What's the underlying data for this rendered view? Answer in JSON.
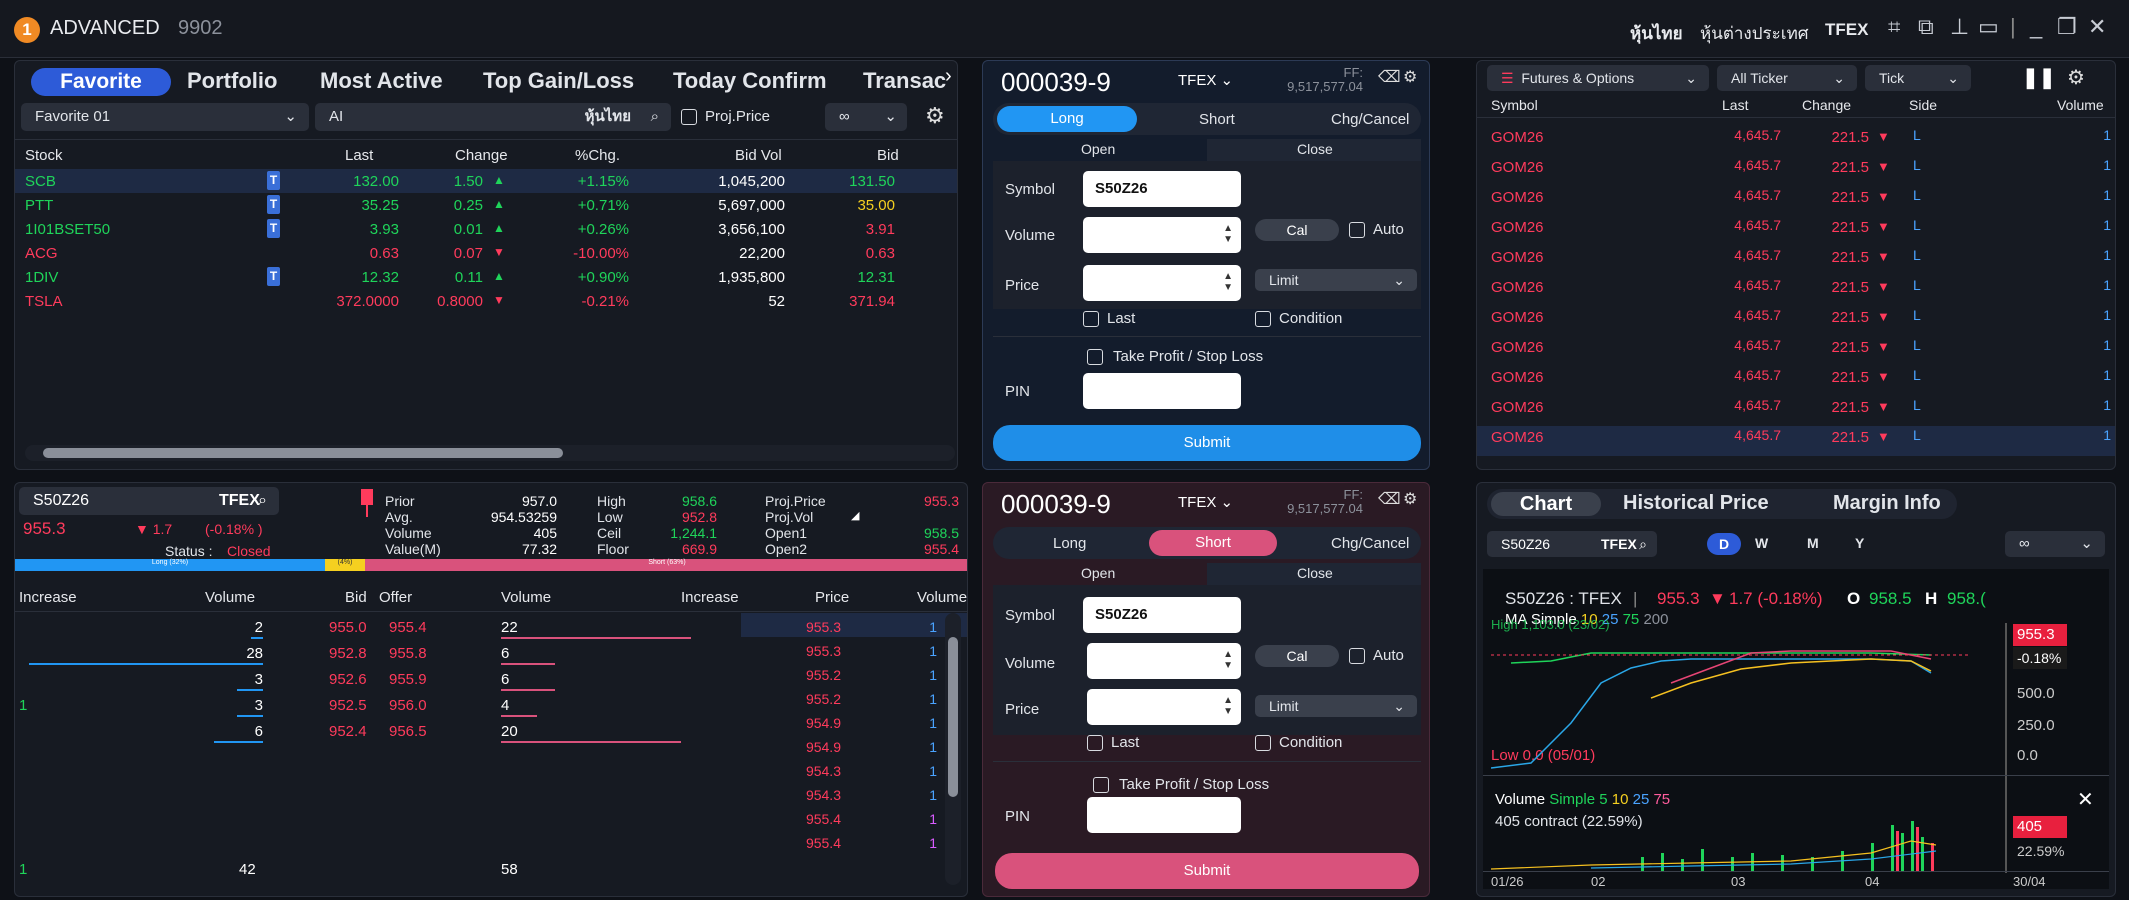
{
  "titlebar": {
    "badge": "1",
    "title": "ADVANCED",
    "account": "9902",
    "links": [
      "หุ้นไทย",
      "หุ้นต่างประเทศ",
      "TFEX"
    ]
  },
  "watchlist": {
    "tabs": [
      "Favorite",
      "Portfolio",
      "Most Active",
      "Top Gain/Loss",
      "Today Confirm",
      "Transac"
    ],
    "list_select": "Favorite 01",
    "search_value": "AI",
    "market_label": "หุ้นไทย",
    "proj_price_label": "Proj.Price",
    "columns": [
      "Stock",
      "Last",
      "Change",
      "%Chg.",
      "Bid Vol",
      "Bid"
    ],
    "rows": [
      {
        "stock": "SCB",
        "t": "T",
        "last": "132.00",
        "change": "1.50",
        "dir": "up",
        "pct": "+1.15%",
        "bidvol": "1,045,200",
        "bid": "131.50",
        "color": "g",
        "bidcolor": "g"
      },
      {
        "stock": "PTT",
        "t": "T",
        "last": "35.25",
        "change": "0.25",
        "dir": "up",
        "pct": "+0.71%",
        "bidvol": "5,697,000",
        "bid": "35.00",
        "color": "g",
        "bidcolor": "y"
      },
      {
        "stock": "1I01BSET50",
        "t": "T",
        "last": "3.93",
        "change": "0.01",
        "dir": "up",
        "pct": "+0.26%",
        "bidvol": "3,656,100",
        "bid": "3.91",
        "color": "g",
        "bidcolor": "r"
      },
      {
        "stock": "ACG",
        "t": "",
        "last": "0.63",
        "change": "0.07",
        "dir": "down",
        "pct": "-10.00%",
        "bidvol": "22,200",
        "bid": "0.63",
        "color": "r",
        "bidcolor": "r"
      },
      {
        "stock": "1DIV",
        "t": "T",
        "last": "12.32",
        "change": "0.11",
        "dir": "up",
        "pct": "+0.90%",
        "bidvol": "1,935,800",
        "bid": "12.31",
        "color": "g",
        "bidcolor": "g"
      },
      {
        "stock": "TSLA",
        "t": "",
        "last": "372.0000",
        "change": "0.8000",
        "dir": "down",
        "pct": "-0.21%",
        "bidvol": "52",
        "bid": "371.94",
        "color": "r",
        "bidcolor": "r"
      }
    ]
  },
  "order_long": {
    "account": "000039-9",
    "market": "TFEX",
    "ff_label": "FF:",
    "ff_value": "9,517,577.04",
    "sides": [
      "Long",
      "Short",
      "Chg/Cancel"
    ],
    "open": "Open",
    "close": "Close",
    "symbol_label": "Symbol",
    "symbol_value": "S50Z26",
    "volume_label": "Volume",
    "cal": "Cal",
    "auto": "Auto",
    "price_label": "Price",
    "price_type": "Limit",
    "last": "Last",
    "condition": "Condition",
    "tpsl": "Take Profit / Stop Loss",
    "pin": "PIN",
    "submit": "Submit"
  },
  "order_short": {
    "account": "000039-9",
    "market": "TFEX",
    "ff_label": "FF:",
    "ff_value": "9,517,577.04",
    "sides": [
      "Long",
      "Short",
      "Chg/Cancel"
    ],
    "open": "Open",
    "close": "Close",
    "symbol_label": "Symbol",
    "symbol_value": "S50Z26",
    "volume_label": "Volume",
    "cal": "Cal",
    "auto": "Auto",
    "price_label": "Price",
    "price_type": "Limit",
    "last": "Last",
    "condition": "Condition",
    "tpsl": "Take Profit / Stop Loss",
    "pin": "PIN",
    "submit": "Submit"
  },
  "ticker": {
    "filter1": "Futures & Options",
    "filter2": "All Ticker",
    "filter3": "Tick",
    "columns": [
      "Symbol",
      "Last",
      "Change",
      "Side",
      "Volume"
    ],
    "rows": [
      {
        "symbol": "GOM26",
        "last": "4,645.7",
        "change": "221.5",
        "side": "L",
        "volume": "1"
      },
      {
        "symbol": "GOM26",
        "last": "4,645.7",
        "change": "221.5",
        "side": "L",
        "volume": "1"
      },
      {
        "symbol": "GOM26",
        "last": "4,645.7",
        "change": "221.5",
        "side": "L",
        "volume": "1"
      },
      {
        "symbol": "GOM26",
        "last": "4,645.7",
        "change": "221.5",
        "side": "L",
        "volume": "1"
      },
      {
        "symbol": "GOM26",
        "last": "4,645.7",
        "change": "221.5",
        "side": "L",
        "volume": "1"
      },
      {
        "symbol": "GOM26",
        "last": "4,645.7",
        "change": "221.5",
        "side": "L",
        "volume": "1"
      },
      {
        "symbol": "GOM26",
        "last": "4,645.7",
        "change": "221.5",
        "side": "L",
        "volume": "1"
      },
      {
        "symbol": "GOM26",
        "last": "4,645.7",
        "change": "221.5",
        "side": "L",
        "volume": "1"
      },
      {
        "symbol": "GOM26",
        "last": "4,645.7",
        "change": "221.5",
        "side": "L",
        "volume": "1"
      },
      {
        "symbol": "GOM26",
        "last": "4,645.7",
        "change": "221.5",
        "side": "L",
        "volume": "1"
      },
      {
        "symbol": "GOM26",
        "last": "4,645.7",
        "change": "221.5",
        "side": "L",
        "volume": "1"
      }
    ]
  },
  "quote": {
    "symbol": "S50Z26",
    "market": "TFEX",
    "price": "955.3",
    "change": "1.7",
    "pct": "(-0.18% )",
    "status_label": "Status :",
    "status_value": "Closed",
    "long_bar": "Long (32%)",
    "mid_bar": "(4%)",
    "short_bar": "Short (63%)",
    "stats": [
      {
        "l1": "Prior",
        "v1": "957.0",
        "l2": "High",
        "v2": "958.6",
        "l3": "Proj.Price",
        "v3": "955.3"
      },
      {
        "l1": "Avg.",
        "v1": "954.53259",
        "l2": "Low",
        "v2": "952.8",
        "l3": "Proj.Vol",
        "v3": ""
      },
      {
        "l1": "Volume",
        "v1": "405",
        "l2": "Ceil",
        "v2": "1,244.1",
        "l3": "Open1",
        "v3": "958.5"
      },
      {
        "l1": "Value(M)",
        "v1": "77.32",
        "l2": "Floor",
        "v2": "669.9",
        "l3": "Open2",
        "v3": "955.4"
      }
    ],
    "depth_columns": [
      "Increase",
      "Volume",
      "Bid",
      "Offer",
      "Volume",
      "Increase"
    ],
    "depth_rows": [
      {
        "inc": "",
        "vol": "2",
        "bid": "955.0",
        "offer": "955.4",
        "ovol": "22",
        "oinc": "",
        "bl": 0.05,
        "ol": 0.95
      },
      {
        "inc": "",
        "vol": "28",
        "bid": "952.8",
        "offer": "955.8",
        "ovol": "6",
        "oinc": "",
        "bl": 1.0,
        "ol": 0.27
      },
      {
        "inc": "",
        "vol": "3",
        "bid": "952.6",
        "offer": "955.9",
        "ovol": "6",
        "oinc": "",
        "bl": 0.11,
        "ol": 0.27
      },
      {
        "inc": "1",
        "vol": "3",
        "bid": "952.5",
        "offer": "956.0",
        "ovol": "4",
        "oinc": "",
        "bl": 0.11,
        "ol": 0.18
      },
      {
        "inc": "",
        "vol": "6",
        "bid": "952.4",
        "offer": "956.5",
        "ovol": "20",
        "oinc": "",
        "bl": 0.21,
        "ol": 0.9
      }
    ],
    "depth_total": {
      "inc": "1",
      "vol": "42",
      "ovol": "58"
    },
    "ticks_columns": [
      "Price",
      "Volume"
    ],
    "ticks": [
      {
        "price": "955.3",
        "vol": "1"
      },
      {
        "price": "955.3",
        "vol": "1"
      },
      {
        "price": "955.2",
        "vol": "1"
      },
      {
        "price": "955.2",
        "vol": "1"
      },
      {
        "price": "954.9",
        "vol": "1"
      },
      {
        "price": "954.9",
        "vol": "1"
      },
      {
        "price": "954.3",
        "vol": "1"
      },
      {
        "price": "954.3",
        "vol": "1"
      },
      {
        "price": "955.4",
        "vol": "1"
      },
      {
        "price": "955.4",
        "vol": "1"
      }
    ]
  },
  "chart": {
    "tabs": [
      "Chart",
      "Historical Price",
      "Margin Info"
    ],
    "symbol": "S50Z26",
    "market": "TFEX",
    "periods": [
      "D",
      "W",
      "M",
      "Y"
    ],
    "header_symbol": "S50Z26 : TFEX",
    "header_price": "955.3",
    "header_change": "1.7 (-0.18%)",
    "header_o": "O",
    "header_o_val": "958.5",
    "header_h": "H",
    "header_h_val": "958.(",
    "ma_label": "MA Simple",
    "ma_periods": [
      "10",
      "25",
      "75",
      "200"
    ],
    "high_label": "High 1,103.0 (23/02)",
    "low_label": "Low 0.0 (05/01)",
    "price_tag": "955.3",
    "pct_tag": "-0.18%",
    "y_ticks": [
      "500.0",
      "250.0",
      "0.0"
    ],
    "volume_label": "Volume",
    "volume_ma": "Simple 5",
    "volume_periods": [
      "10",
      "25",
      "75"
    ],
    "volume_value": "405 contract (22.59%)",
    "vol_tag": "405",
    "vol_pct": "22.59%",
    "x_ticks": [
      "01/26",
      "02",
      "03",
      "04",
      "30/04"
    ]
  },
  "colors": {
    "accent": "#2d5bd8",
    "long": "#2196f3",
    "short": "#d9527c",
    "up": "#1fd45a",
    "down": "#ff3b5c"
  }
}
